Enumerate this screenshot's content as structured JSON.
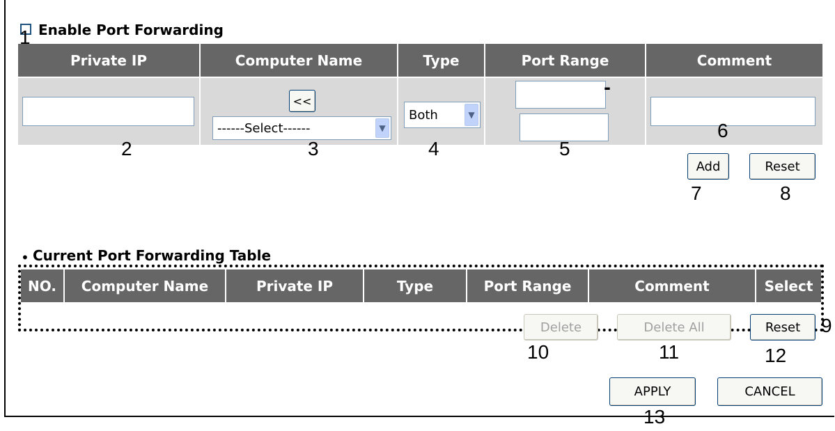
{
  "enable": {
    "label": "Enable Port Forwarding"
  },
  "form": {
    "headers": [
      "Private IP",
      "Computer Name",
      "Type",
      "Port Range",
      "Comment"
    ],
    "back_button": "<<",
    "computer_select": "------Select------",
    "type_select": "Both",
    "range_dash": "-",
    "add_button": "Add",
    "reset_button": "Reset"
  },
  "table": {
    "title": "Current Port Forwarding Table",
    "headers": [
      "NO.",
      "Computer Name",
      "Private IP",
      "Type",
      "Port Range",
      "Comment",
      "Select"
    ],
    "delete_button": "Delete",
    "delete_all_button": "Delete All",
    "reset_button": "Reset"
  },
  "footer": {
    "apply_button": "APPLY",
    "cancel_button": "CANCEL"
  },
  "callouts": [
    "1",
    "2",
    "3",
    "4",
    "5",
    "6",
    "7",
    "8",
    "9",
    "10",
    "11",
    "12",
    "13"
  ]
}
